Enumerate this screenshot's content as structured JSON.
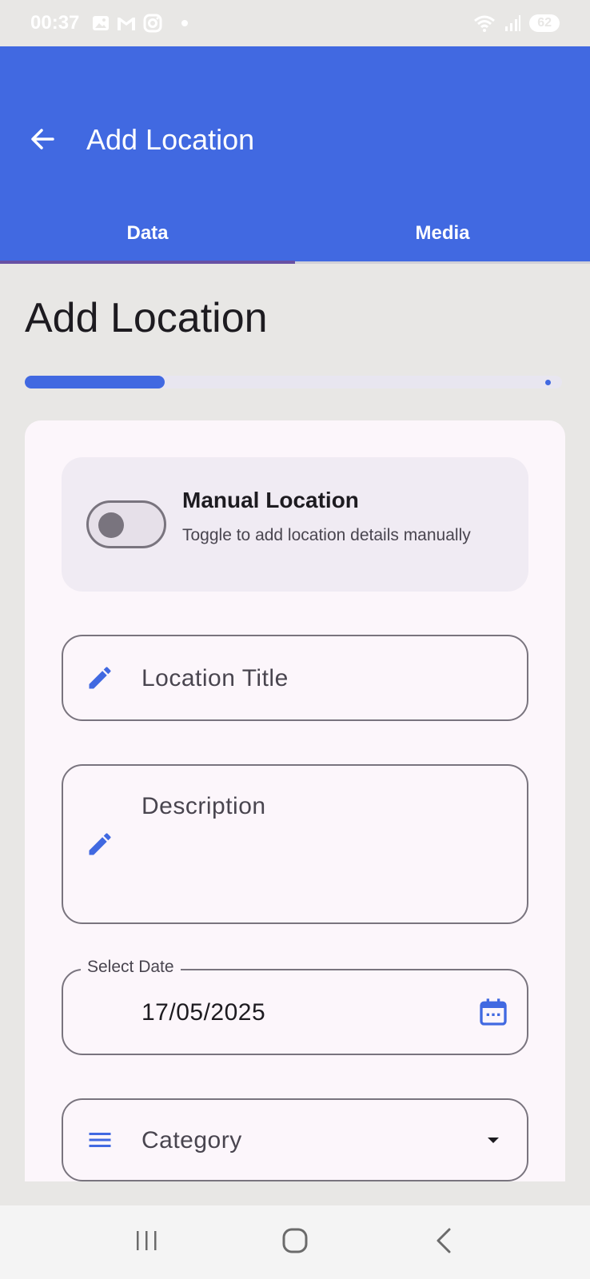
{
  "status_bar": {
    "time": "00:37",
    "icons": [
      "gallery-icon",
      "gmail-icon",
      "instagram-icon"
    ],
    "battery": "62"
  },
  "app_bar": {
    "title": "Add Location",
    "back_icon": "arrow-back-icon",
    "color": "#4169e1"
  },
  "tabs": [
    {
      "label": "Data",
      "selected": true
    },
    {
      "label": "Media",
      "selected": false
    }
  ],
  "page": {
    "heading": "Add Location",
    "progress_fraction": 0.26
  },
  "manual_location": {
    "title": "Manual Location",
    "subtitle": "Toggle to add location details manually",
    "enabled": false
  },
  "form": {
    "title_field": {
      "placeholder": "Location Title",
      "icon": "pencil-icon"
    },
    "description_field": {
      "placeholder": "Description",
      "icon": "pencil-icon"
    },
    "date_field": {
      "label": "Select Date",
      "value": "17/05/2025",
      "icon": "calendar-icon"
    },
    "category_field": {
      "placeholder": "Category",
      "icon": "list-icon",
      "trailing_icon": "dropdown-arrow-icon"
    }
  },
  "nav_bar": {
    "buttons": [
      "recents-icon",
      "home-icon",
      "back-icon"
    ]
  }
}
